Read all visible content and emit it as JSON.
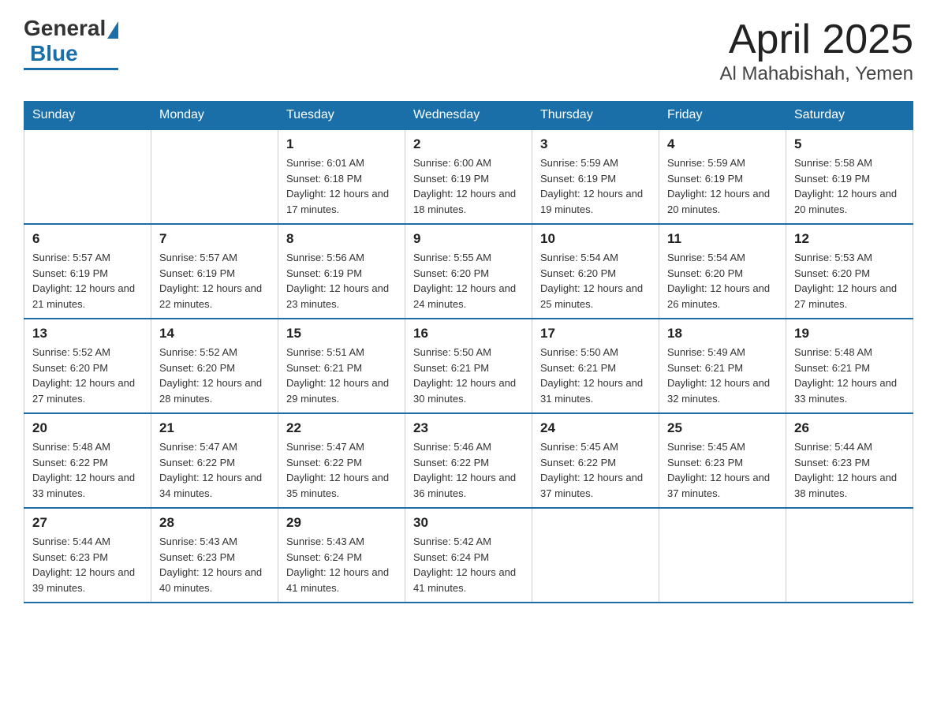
{
  "header": {
    "logo_general": "General",
    "logo_blue": "Blue",
    "title": "April 2025",
    "subtitle": "Al Mahabishah, Yemen"
  },
  "calendar": {
    "days_of_week": [
      "Sunday",
      "Monday",
      "Tuesday",
      "Wednesday",
      "Thursday",
      "Friday",
      "Saturday"
    ],
    "weeks": [
      [
        {
          "day": "",
          "sunrise": "",
          "sunset": "",
          "daylight": ""
        },
        {
          "day": "",
          "sunrise": "",
          "sunset": "",
          "daylight": ""
        },
        {
          "day": "1",
          "sunrise": "Sunrise: 6:01 AM",
          "sunset": "Sunset: 6:18 PM",
          "daylight": "Daylight: 12 hours and 17 minutes."
        },
        {
          "day": "2",
          "sunrise": "Sunrise: 6:00 AM",
          "sunset": "Sunset: 6:19 PM",
          "daylight": "Daylight: 12 hours and 18 minutes."
        },
        {
          "day": "3",
          "sunrise": "Sunrise: 5:59 AM",
          "sunset": "Sunset: 6:19 PM",
          "daylight": "Daylight: 12 hours and 19 minutes."
        },
        {
          "day": "4",
          "sunrise": "Sunrise: 5:59 AM",
          "sunset": "Sunset: 6:19 PM",
          "daylight": "Daylight: 12 hours and 20 minutes."
        },
        {
          "day": "5",
          "sunrise": "Sunrise: 5:58 AM",
          "sunset": "Sunset: 6:19 PM",
          "daylight": "Daylight: 12 hours and 20 minutes."
        }
      ],
      [
        {
          "day": "6",
          "sunrise": "Sunrise: 5:57 AM",
          "sunset": "Sunset: 6:19 PM",
          "daylight": "Daylight: 12 hours and 21 minutes."
        },
        {
          "day": "7",
          "sunrise": "Sunrise: 5:57 AM",
          "sunset": "Sunset: 6:19 PM",
          "daylight": "Daylight: 12 hours and 22 minutes."
        },
        {
          "day": "8",
          "sunrise": "Sunrise: 5:56 AM",
          "sunset": "Sunset: 6:19 PM",
          "daylight": "Daylight: 12 hours and 23 minutes."
        },
        {
          "day": "9",
          "sunrise": "Sunrise: 5:55 AM",
          "sunset": "Sunset: 6:20 PM",
          "daylight": "Daylight: 12 hours and 24 minutes."
        },
        {
          "day": "10",
          "sunrise": "Sunrise: 5:54 AM",
          "sunset": "Sunset: 6:20 PM",
          "daylight": "Daylight: 12 hours and 25 minutes."
        },
        {
          "day": "11",
          "sunrise": "Sunrise: 5:54 AM",
          "sunset": "Sunset: 6:20 PM",
          "daylight": "Daylight: 12 hours and 26 minutes."
        },
        {
          "day": "12",
          "sunrise": "Sunrise: 5:53 AM",
          "sunset": "Sunset: 6:20 PM",
          "daylight": "Daylight: 12 hours and 27 minutes."
        }
      ],
      [
        {
          "day": "13",
          "sunrise": "Sunrise: 5:52 AM",
          "sunset": "Sunset: 6:20 PM",
          "daylight": "Daylight: 12 hours and 27 minutes."
        },
        {
          "day": "14",
          "sunrise": "Sunrise: 5:52 AM",
          "sunset": "Sunset: 6:20 PM",
          "daylight": "Daylight: 12 hours and 28 minutes."
        },
        {
          "day": "15",
          "sunrise": "Sunrise: 5:51 AM",
          "sunset": "Sunset: 6:21 PM",
          "daylight": "Daylight: 12 hours and 29 minutes."
        },
        {
          "day": "16",
          "sunrise": "Sunrise: 5:50 AM",
          "sunset": "Sunset: 6:21 PM",
          "daylight": "Daylight: 12 hours and 30 minutes."
        },
        {
          "day": "17",
          "sunrise": "Sunrise: 5:50 AM",
          "sunset": "Sunset: 6:21 PM",
          "daylight": "Daylight: 12 hours and 31 minutes."
        },
        {
          "day": "18",
          "sunrise": "Sunrise: 5:49 AM",
          "sunset": "Sunset: 6:21 PM",
          "daylight": "Daylight: 12 hours and 32 minutes."
        },
        {
          "day": "19",
          "sunrise": "Sunrise: 5:48 AM",
          "sunset": "Sunset: 6:21 PM",
          "daylight": "Daylight: 12 hours and 33 minutes."
        }
      ],
      [
        {
          "day": "20",
          "sunrise": "Sunrise: 5:48 AM",
          "sunset": "Sunset: 6:22 PM",
          "daylight": "Daylight: 12 hours and 33 minutes."
        },
        {
          "day": "21",
          "sunrise": "Sunrise: 5:47 AM",
          "sunset": "Sunset: 6:22 PM",
          "daylight": "Daylight: 12 hours and 34 minutes."
        },
        {
          "day": "22",
          "sunrise": "Sunrise: 5:47 AM",
          "sunset": "Sunset: 6:22 PM",
          "daylight": "Daylight: 12 hours and 35 minutes."
        },
        {
          "day": "23",
          "sunrise": "Sunrise: 5:46 AM",
          "sunset": "Sunset: 6:22 PM",
          "daylight": "Daylight: 12 hours and 36 minutes."
        },
        {
          "day": "24",
          "sunrise": "Sunrise: 5:45 AM",
          "sunset": "Sunset: 6:22 PM",
          "daylight": "Daylight: 12 hours and 37 minutes."
        },
        {
          "day": "25",
          "sunrise": "Sunrise: 5:45 AM",
          "sunset": "Sunset: 6:23 PM",
          "daylight": "Daylight: 12 hours and 37 minutes."
        },
        {
          "day": "26",
          "sunrise": "Sunrise: 5:44 AM",
          "sunset": "Sunset: 6:23 PM",
          "daylight": "Daylight: 12 hours and 38 minutes."
        }
      ],
      [
        {
          "day": "27",
          "sunrise": "Sunrise: 5:44 AM",
          "sunset": "Sunset: 6:23 PM",
          "daylight": "Daylight: 12 hours and 39 minutes."
        },
        {
          "day": "28",
          "sunrise": "Sunrise: 5:43 AM",
          "sunset": "Sunset: 6:23 PM",
          "daylight": "Daylight: 12 hours and 40 minutes."
        },
        {
          "day": "29",
          "sunrise": "Sunrise: 5:43 AM",
          "sunset": "Sunset: 6:24 PM",
          "daylight": "Daylight: 12 hours and 41 minutes."
        },
        {
          "day": "30",
          "sunrise": "Sunrise: 5:42 AM",
          "sunset": "Sunset: 6:24 PM",
          "daylight": "Daylight: 12 hours and 41 minutes."
        },
        {
          "day": "",
          "sunrise": "",
          "sunset": "",
          "daylight": ""
        },
        {
          "day": "",
          "sunrise": "",
          "sunset": "",
          "daylight": ""
        },
        {
          "day": "",
          "sunrise": "",
          "sunset": "",
          "daylight": ""
        }
      ]
    ]
  }
}
